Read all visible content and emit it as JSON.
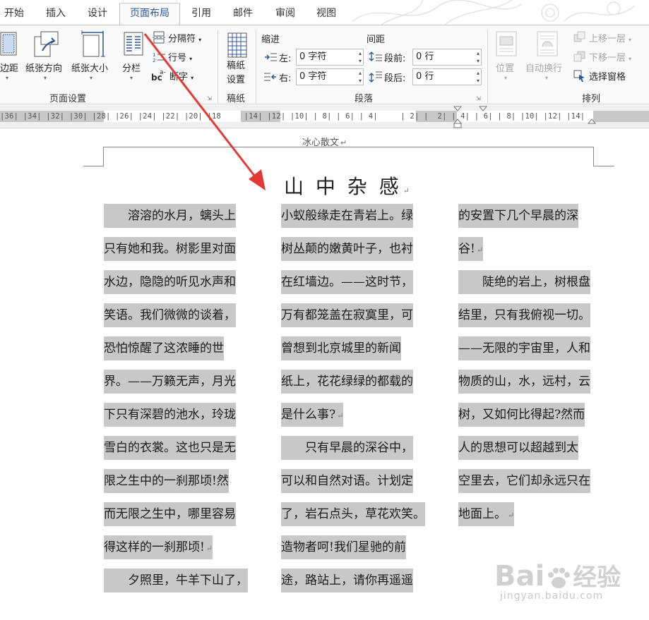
{
  "tabs": [
    {
      "label": "开始",
      "active": false
    },
    {
      "label": "插入",
      "active": false
    },
    {
      "label": "设计",
      "active": false
    },
    {
      "label": "页面布局",
      "active": true
    },
    {
      "label": "引用",
      "active": false
    },
    {
      "label": "邮件",
      "active": false
    },
    {
      "label": "审阅",
      "active": false
    },
    {
      "label": "视图",
      "active": false
    }
  ],
  "ribbon": {
    "page_setup": {
      "margins": "边距",
      "orientation": "纸张方向",
      "size": "纸张大小",
      "columns": "分栏",
      "breaks": "分隔符",
      "line_numbers": "行号",
      "hyphenation": "断字",
      "group_label": "页面设置"
    },
    "draft": {
      "button": "稿纸\n设置",
      "group_label": "稿纸"
    },
    "paragraph": {
      "indent_header": "缩进",
      "spacing_header": "间距",
      "left_label": "左:",
      "right_label": "右:",
      "before_label": "段前:",
      "after_label": "段后:",
      "left_value": "0 字符",
      "right_value": "0 字符",
      "before_value": "0 行",
      "after_value": "0 行",
      "group_label": "段落"
    },
    "arrange": {
      "position": "位置",
      "wrap_text": "自动换行",
      "bring_forward": "上移一层",
      "send_backward": "下移一层",
      "selection_pane": "选择窗格",
      "group_label": "排列"
    }
  },
  "ruler": {
    "ticks": "|36| |34| |32| |30| |28| |26| |24| |22| |20| |18     |14| |12| |10| | 8| | 6| | 4|     | 2| |  2| | 4| | 6| | 8| |10| |12| |14|"
  },
  "document": {
    "header": "冰心散文",
    "title": "山 中 杂 感",
    "col1": [
      "　　溶溶的水月，螭头上",
      "只有她和我。树影里对面",
      "水边，隐隐的听见水声和",
      "笑语。我们微微的谈着，",
      "恐怕惊醒了这浓睡的世",
      "界。——万籁无声，月光",
      "下只有深碧的池水，玲珑",
      "雪白的衣裳。这也只是无",
      "限之生中的一刹那顷!然",
      "而无限之生中，哪里容易",
      "得这样的一刹那顷!",
      "　　夕照里，牛羊下山了，"
    ],
    "col2": [
      "小蚁般缘走在青岩上。绿",
      "树丛颠的嫩黄叶子，也衬",
      "在红墙边。——这时节，",
      "万有都笼盖在寂寞里，可",
      "曾想到北京城里的新闻",
      "纸上，花花绿绿的都载的",
      "是什么事?",
      "　　只有早晨的深谷中，",
      "可以和自然对语。计划定",
      "了，岩石点头，草花欢笑。",
      "造物者呵!我们星驰的前",
      "途，路站上，请你再遥遥"
    ],
    "col3": [
      "的安置下几个早晨的深",
      "谷!",
      "　　陡绝的岩上，树根盘",
      "结里，只有我俯视一切。",
      "——无限的宇宙里，人和",
      "物质的山，水，远村，云",
      "树，又如何比得起?然而",
      "人的思想可以超越到太",
      "空里去，它们却永远只在",
      "地面上。"
    ]
  },
  "watermark": {
    "brand": "Bai",
    "brand2": "经验",
    "url": "jingyan.baidu.com"
  },
  "colors": {
    "accent": "#2b579a",
    "arrow": "#e53935",
    "highlight": "#c8c8c8"
  }
}
